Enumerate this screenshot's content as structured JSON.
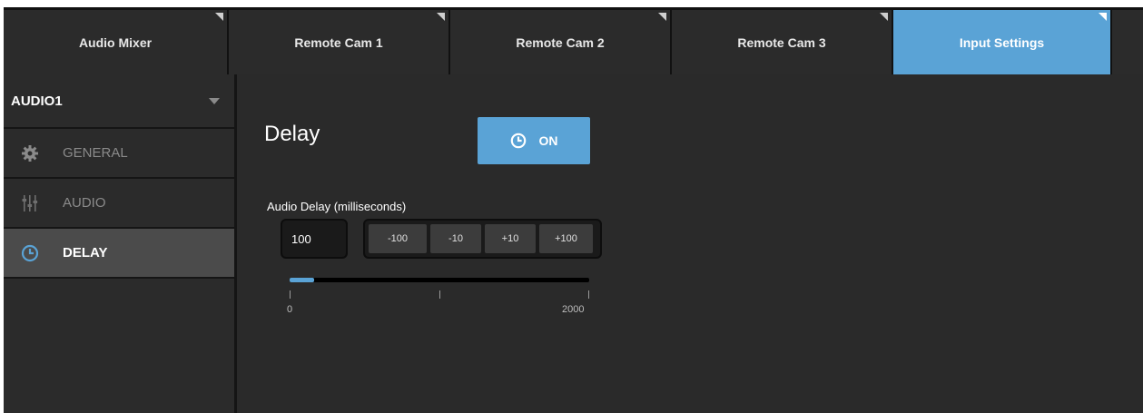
{
  "tabs": [
    {
      "label": "Audio Mixer",
      "active": false
    },
    {
      "label": "Remote Cam 1",
      "active": false
    },
    {
      "label": "Remote Cam 2",
      "active": false
    },
    {
      "label": "Remote Cam 3",
      "active": false
    },
    {
      "label": "Input Settings",
      "active": true
    }
  ],
  "sidebar": {
    "source": "AUDIO1",
    "items": [
      {
        "label": "GENERAL",
        "icon": "gear-icon",
        "active": false
      },
      {
        "label": "AUDIO",
        "icon": "sliders-icon",
        "active": false
      },
      {
        "label": "DELAY",
        "icon": "clock-icon",
        "active": true
      }
    ]
  },
  "main": {
    "title": "Delay",
    "toggle_label": "ON",
    "field_label": "Audio Delay (milliseconds)",
    "delay_value": "100",
    "step_buttons": [
      "-100",
      "-10",
      "+10",
      "+100"
    ],
    "slider": {
      "min": 0,
      "max": 2000,
      "value": 100,
      "min_label": "0",
      "max_label": "2000"
    }
  },
  "colors": {
    "accent": "#5aa3d6",
    "background": "#2a2a2a",
    "tab_bg": "#2b2b2b"
  }
}
